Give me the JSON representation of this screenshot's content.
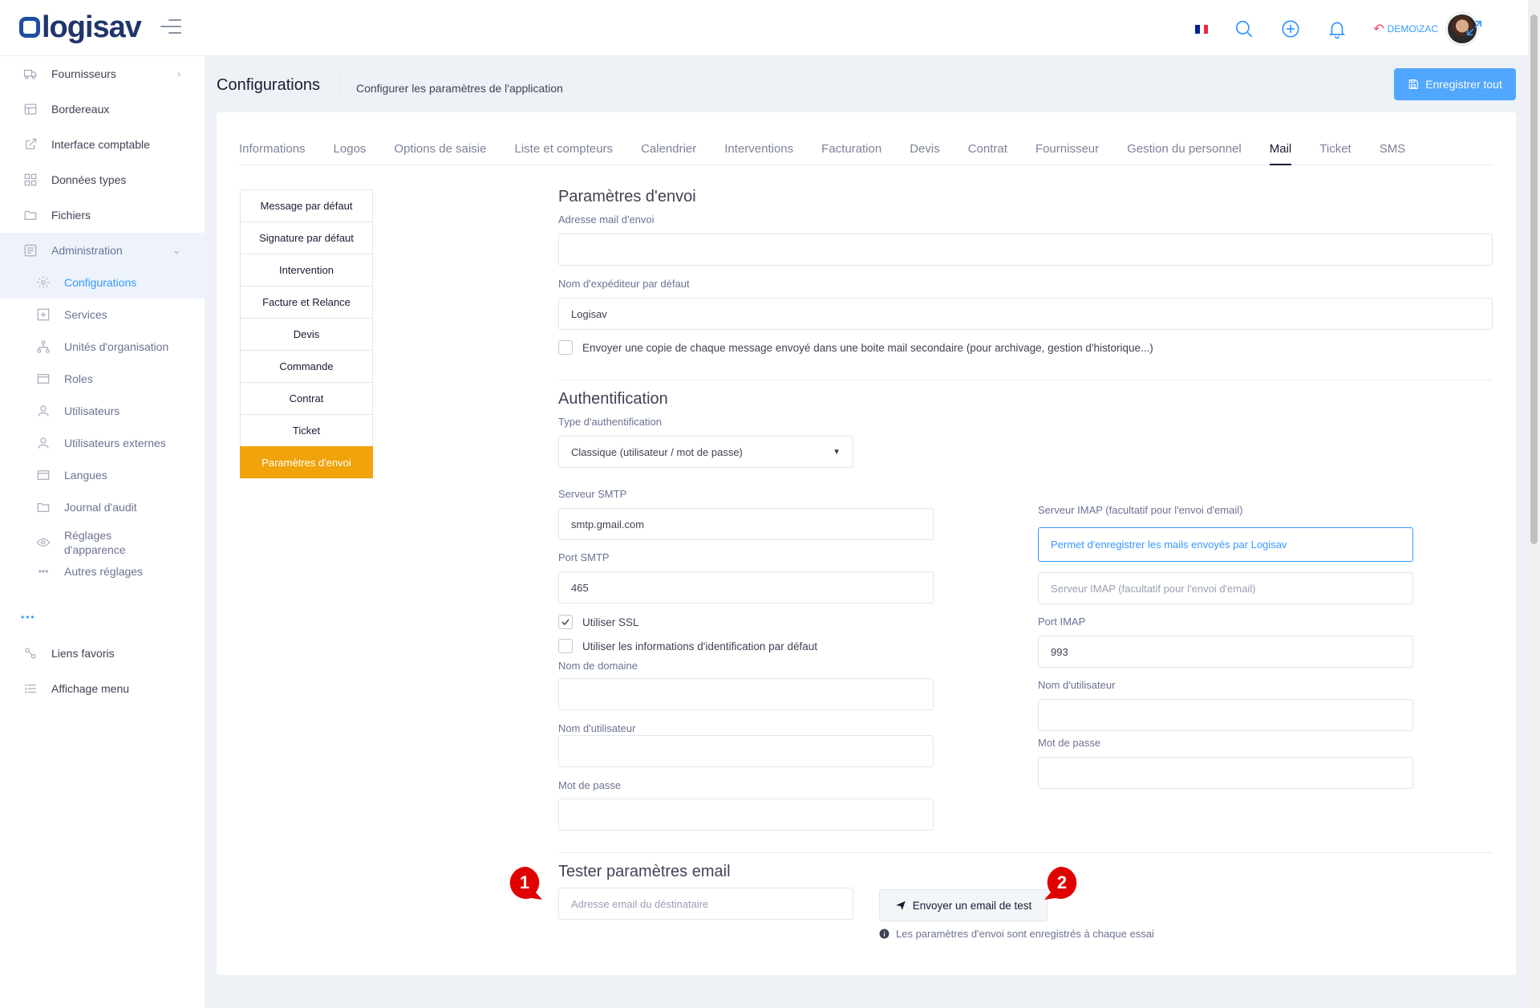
{
  "app": {
    "logo": "logisav"
  },
  "topbar": {
    "user": "DEMO\\ZAC"
  },
  "sidebar": {
    "items": [
      {
        "label": "Fournisseurs",
        "icon": "truck-icon"
      },
      {
        "label": "Bordereaux",
        "icon": "table-icon"
      },
      {
        "label": "Interface comptable",
        "icon": "external-link-icon"
      },
      {
        "label": "Données types",
        "icon": "grid-icon"
      },
      {
        "label": "Fichiers",
        "icon": "folder-icon"
      },
      {
        "label": "Administration",
        "icon": "admin-icon"
      }
    ],
    "subitems": [
      {
        "label": "Configurations",
        "icon": "gear-icon"
      },
      {
        "label": "Services",
        "icon": "services-icon"
      },
      {
        "label": "Unités d'organisation",
        "icon": "org-icon"
      },
      {
        "label": "Roles",
        "icon": "roles-icon"
      },
      {
        "label": "Utilisateurs",
        "icon": "user-icon"
      },
      {
        "label": "Utilisateurs externes",
        "icon": "user-external-icon"
      },
      {
        "label": "Langues",
        "icon": "languages-icon"
      },
      {
        "label": "Journal d'audit",
        "icon": "audit-icon"
      },
      {
        "label": "Réglages d'apparence",
        "icon": "eye-icon"
      },
      {
        "label": "Autres réglages",
        "icon": "more-icon"
      }
    ],
    "dots": "•••",
    "bottom": [
      {
        "label": "Liens favoris",
        "icon": "link-icon"
      },
      {
        "label": "Affichage menu",
        "icon": "list-icon"
      }
    ]
  },
  "header": {
    "title": "Configurations",
    "description": "Configurer les paramètres de l'application",
    "save_all": "Enregistrer tout"
  },
  "tabs": [
    "Informations",
    "Logos",
    "Options de saisie",
    "Liste et compteurs",
    "Calendrier",
    "Interventions",
    "Facturation",
    "Devis",
    "Contrat",
    "Fournisseur",
    "Gestion du personnel",
    "Mail",
    "Ticket",
    "SMS"
  ],
  "active_tab": "Mail",
  "vtabs": [
    "Message par défaut",
    "Signature par défaut",
    "Intervention",
    "Facture et Relance",
    "Devis",
    "Commande",
    "Contrat",
    "Ticket",
    "Paramètres d'envoi"
  ],
  "active_vtab": "Paramètres d'envoi",
  "envoi": {
    "title": "Paramètres d'envoi",
    "address_label": "Adresse mail d'envoi",
    "address_value": "",
    "sender_label": "Nom d'expéditeur par défaut",
    "sender_value": "Logisav",
    "copy_label": "Envoyer une copie de chaque message envoyé dans une boite mail secondaire (pour archivage, gestion d'historique...)"
  },
  "auth": {
    "title": "Authentification",
    "type_label": "Type d'authentification",
    "type_value": "Classique (utilisateur / mot de passe)",
    "smtp_label": "Serveur SMTP",
    "smtp_value": "smtp.gmail.com",
    "port_label": "Port SMTP",
    "port_value": "465",
    "ssl_label": "Utiliser SSL",
    "default_cred_label": "Utiliser les informations d'identification par défaut",
    "domain_label": "Nom de domaine",
    "user_label": "Nom d'utilisateur",
    "pass_label": "Mot de passe",
    "imap_label": "Serveur IMAP (facultatif pour l'envoi d'email)",
    "imap_hint": "Permet d'enregistrer les mails envoyés par Logisav",
    "imap_placeholder": "Serveur IMAP (facultatif pour l'envoi d'email)",
    "imap_port_label": "Port IMAP",
    "imap_port_value": "993",
    "imap_user_label": "Nom d'utilisateur",
    "imap_pass_label": "Mot de passe"
  },
  "test": {
    "title": "Tester paramètres email",
    "placeholder": "Adresse email du déstinataire",
    "button": "Envoyer un email de test",
    "note": "Les paramètres d'envoi sont enregistrés à chaque essai"
  },
  "callouts": [
    "1",
    "2"
  ],
  "colors": {
    "accent": "#3699ff",
    "active_tab": "#f0a30a",
    "callout": "#e00000"
  }
}
